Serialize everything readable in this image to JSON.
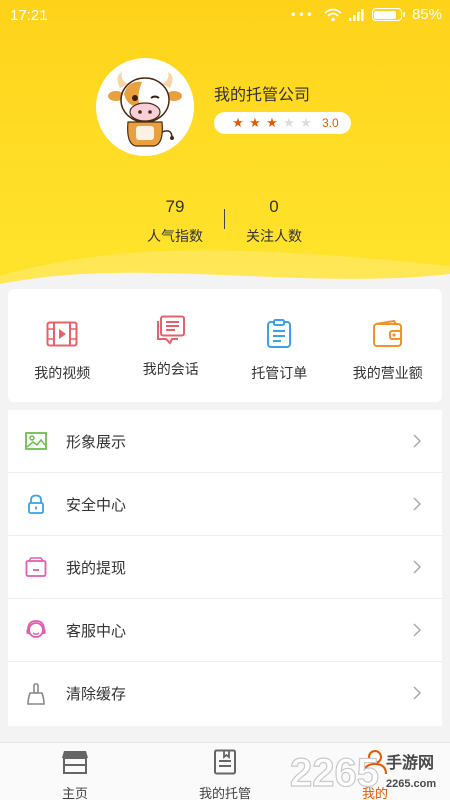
{
  "status_bar": {
    "time": "17:21",
    "dots": "•••",
    "battery": "85%",
    "battery_level": 0.85
  },
  "profile": {
    "company_name": "我的托管公司",
    "rating": {
      "value": "3.0",
      "stars_filled": 3,
      "stars_total": 5
    }
  },
  "stats": [
    {
      "value": "79",
      "label": "人气指数"
    },
    {
      "value": "0",
      "label": "关注人数"
    }
  ],
  "quick_actions": [
    {
      "label": "我的视频",
      "icon": "video-icon",
      "color": "#e8606a"
    },
    {
      "label": "我的会话",
      "icon": "chat-icon",
      "color": "#e8606a"
    },
    {
      "label": "托管订单",
      "icon": "order-clipboard-icon",
      "color": "#3aa3e3"
    },
    {
      "label": "我的营业额",
      "icon": "wallet-icon",
      "color": "#f0932b"
    }
  ],
  "menu": [
    {
      "label": "形象展示",
      "icon": "image-icon",
      "color": "#6bbf4e"
    },
    {
      "label": "安全中心",
      "icon": "lock-icon",
      "color": "#3aa3e3"
    },
    {
      "label": "我的提现",
      "icon": "withdraw-icon",
      "color": "#e35bb0"
    },
    {
      "label": "客服中心",
      "icon": "customer-service-icon",
      "color": "#e35bb0"
    },
    {
      "label": "清除缓存",
      "icon": "broom-icon",
      "color": "#888888"
    }
  ],
  "tabs": [
    {
      "label": "主页",
      "icon": "store-icon",
      "active": false
    },
    {
      "label": "我的托管",
      "icon": "document-icon",
      "active": false
    },
    {
      "label": "我的",
      "icon": "person-icon",
      "active": true
    }
  ],
  "watermark": {
    "number": "2265",
    "text": "手游网",
    "domain": "2265.com"
  },
  "colors": {
    "header_yellow": "#ffd21a",
    "accent_orange": "#e85a00",
    "star_filled": "#e65a00",
    "star_empty": "#dddddd"
  }
}
